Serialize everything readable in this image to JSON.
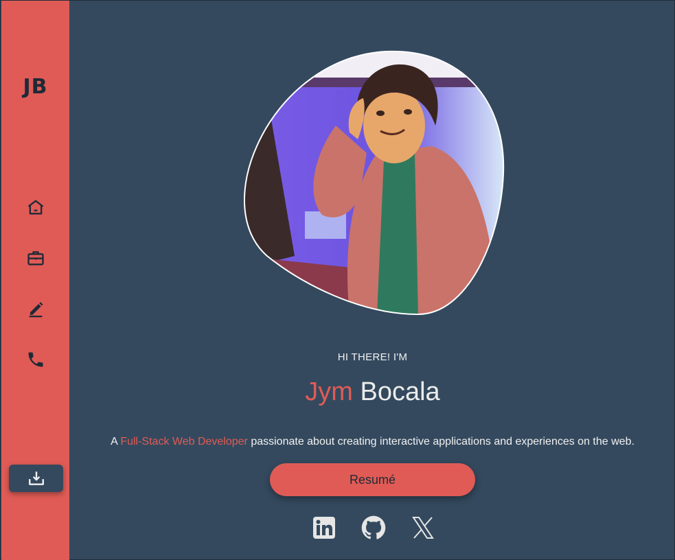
{
  "sidebar": {
    "logo": "JB",
    "nav": [
      {
        "icon": "home-icon"
      },
      {
        "icon": "briefcase-icon"
      },
      {
        "icon": "pencil-icon"
      },
      {
        "icon": "phone-icon"
      }
    ],
    "download_icon": "download-icon"
  },
  "hero": {
    "greeting": "HI THERE! I'M",
    "first_name": "Jym",
    "last_name": "Bocala",
    "tagline_prefix": "A ",
    "tagline_highlight": "Full-Stack Web Developer",
    "tagline_suffix": " passionate about creating interactive applications and experiences on the web.",
    "resume_label": "Resumé"
  },
  "socials": [
    {
      "icon": "linkedin-icon"
    },
    {
      "icon": "github-icon"
    },
    {
      "icon": "x-icon"
    }
  ],
  "colors": {
    "background": "#34495e",
    "accent": "#e05b56",
    "text": "#f1f1f1",
    "icon": "#1e2a36"
  }
}
